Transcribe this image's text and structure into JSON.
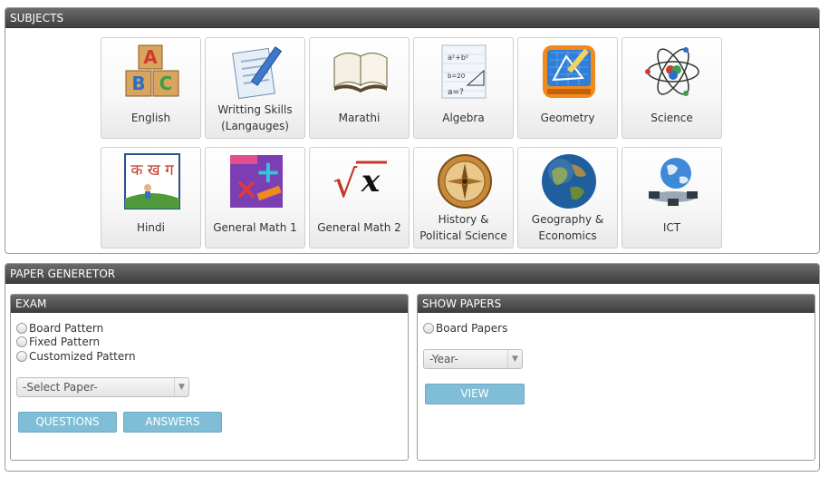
{
  "subjects": {
    "title": "SUBJECTS",
    "tiles": [
      {
        "label": "English",
        "icon": "abc-blocks-icon"
      },
      {
        "label": "Writting Skills (Langauges)",
        "icon": "notepad-pencil-icon"
      },
      {
        "label": "Marathi",
        "icon": "open-book-icon"
      },
      {
        "label": "Algebra",
        "icon": "algebra-sheet-icon"
      },
      {
        "label": "Geometry",
        "icon": "geometry-app-icon"
      },
      {
        "label": "Science",
        "icon": "atom-icon"
      },
      {
        "label": "Hindi",
        "icon": "hindi-letters-icon"
      },
      {
        "label": "General Math 1",
        "icon": "math-symbols-icon"
      },
      {
        "label": "General Math 2",
        "icon": "square-root-icon"
      },
      {
        "label": "History & Political Science",
        "icon": "compass-icon"
      },
      {
        "label": "Geography & Economics",
        "icon": "globe-icon"
      },
      {
        "label": "ICT",
        "icon": "network-globe-icon"
      }
    ],
    "hindi_letters": "क ख ग",
    "math_glyphs": {
      "root": "√",
      "x": "x",
      "plus": "+",
      "times": "×"
    }
  },
  "paper_generator": {
    "title": "PAPER GENERETOR",
    "exam": {
      "title": "EXAM",
      "options": [
        "Board Pattern",
        "Fixed Pattern",
        "Customized Pattern"
      ],
      "select_value": "-Select Paper-",
      "questions_label": "QUESTIONS",
      "answers_label": "ANSWERS"
    },
    "show_papers": {
      "title": "SHOW PAPERS",
      "option": "Board Papers",
      "year_value": "-Year-",
      "view_label": "VIEW"
    }
  },
  "colors": {
    "header_dark": "#3f3f3f",
    "button_blue": "#7fbed6"
  }
}
